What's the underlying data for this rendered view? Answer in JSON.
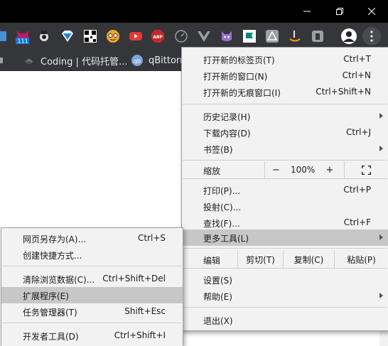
{
  "window": {
    "minimize_icon": "minimize-icon",
    "maximize_icon": "restore-icon",
    "close_icon": "close-icon"
  },
  "toolbar": {
    "extensions": [
      {
        "name": "github-cat-icon",
        "badge": "111"
      },
      {
        "name": "coffee-icon"
      },
      {
        "name": "vpn-gem-icon"
      },
      {
        "name": "qr-code-icon"
      },
      {
        "name": "face-icon"
      },
      {
        "name": "youtube-icon"
      },
      {
        "name": "adblock-icon",
        "badge": "ABP"
      },
      {
        "name": "speed-dial-icon"
      },
      {
        "name": "vue-devtools-icon"
      },
      {
        "name": "cat-icon"
      },
      {
        "name": "flag-icon"
      },
      {
        "name": "triangle-icon"
      },
      {
        "name": "amazon-assistant-icon"
      },
      {
        "name": "ghostery-icon"
      }
    ],
    "profile_icon": "avatar",
    "menu_icon": "three-dots-icon"
  },
  "bookmarks": {
    "items": [
      {
        "label": "Coding | 代码托管..."
      },
      {
        "label": "qBittorr"
      }
    ]
  },
  "main_menu": {
    "items": [
      {
        "label": "打开新的标签页(T)",
        "shortcut": "Ctrl+T"
      },
      {
        "label": "打开新的窗口(N)",
        "shortcut": "Ctrl+N"
      },
      {
        "label": "打开新的无痕窗口(I)",
        "shortcut": "Ctrl+Shift+N"
      },
      {
        "label": "历史记录(H)",
        "shortcut": ""
      },
      {
        "label": "下载内容(D)",
        "shortcut": "Ctrl+J"
      },
      {
        "label": "书签(B)",
        "shortcut": ""
      },
      {
        "label": "打印(P)...",
        "shortcut": "Ctrl+P"
      },
      {
        "label": "投射(C)...",
        "shortcut": ""
      },
      {
        "label": "查找(F)...",
        "shortcut": "Ctrl+F"
      },
      {
        "label": "更多工具(L)",
        "shortcut": ""
      },
      {
        "label": "设置(S)",
        "shortcut": ""
      },
      {
        "label": "帮助(E)",
        "shortcut": ""
      },
      {
        "label": "退出(X)",
        "shortcut": ""
      }
    ],
    "zoom": {
      "label": "缩放",
      "minus": "−",
      "value": "100%",
      "plus": "+"
    },
    "edit": {
      "label": "编辑",
      "cut": "剪切(T)",
      "copy": "复制(C)",
      "paste": "粘贴(P)"
    }
  },
  "sub_menu": {
    "items": [
      {
        "label": "网页另存为(A)...",
        "shortcut": "Ctrl+S"
      },
      {
        "label": "创建快捷方式...",
        "shortcut": ""
      },
      {
        "label": "清除浏览数据(C)...",
        "shortcut": "Ctrl+Shift+Del"
      },
      {
        "label": "扩展程序(E)",
        "shortcut": ""
      },
      {
        "label": "任务管理器(T)",
        "shortcut": "Shift+Esc"
      },
      {
        "label": "开发者工具(D)",
        "shortcut": "Ctrl+Shift+I"
      }
    ]
  },
  "colors": {
    "titlebar": "#000000",
    "toolbar": "#35363a",
    "menu_bg": "#f2f2f2",
    "menu_highlight": "#c7c7c7"
  }
}
